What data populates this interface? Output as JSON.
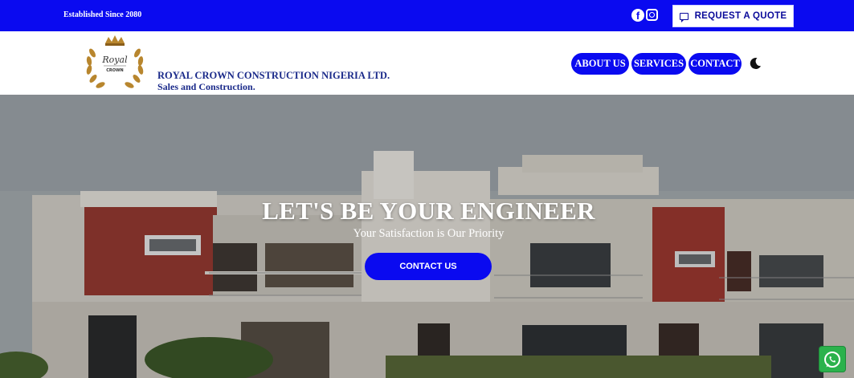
{
  "topbar": {
    "established": "Established Since 2080",
    "social": [
      {
        "icon": "facebook-icon",
        "glyph": "f"
      },
      {
        "icon": "instagram-icon"
      }
    ],
    "quote_button": {
      "label": "REQUEST A QUOTE",
      "icon": "chat-icon"
    }
  },
  "header": {
    "logo": {
      "top_text": "Royal",
      "bottom_text": "CROWN"
    },
    "company_name": "ROYAL CROWN CONSTRUCTION NIGERIA LTD.",
    "tagline": "Sales and Construction.",
    "nav": [
      {
        "label": "ABOUT US"
      },
      {
        "label": "SERVICES"
      },
      {
        "label": "CONTACT"
      }
    ],
    "theme_toggle_icon": "moon-icon"
  },
  "hero": {
    "title": "LET'S BE YOUR ENGINEER",
    "subtitle": "Your Satisfaction is Our Priority",
    "cta_label": "CONTACT US"
  },
  "floating": {
    "icon": "whatsapp-icon"
  },
  "colors": {
    "brand_blue": "#0a0af0",
    "text_navy": "#1a2a8a",
    "whatsapp_green": "#2bb24c",
    "logo_gold": "#b8862e"
  }
}
